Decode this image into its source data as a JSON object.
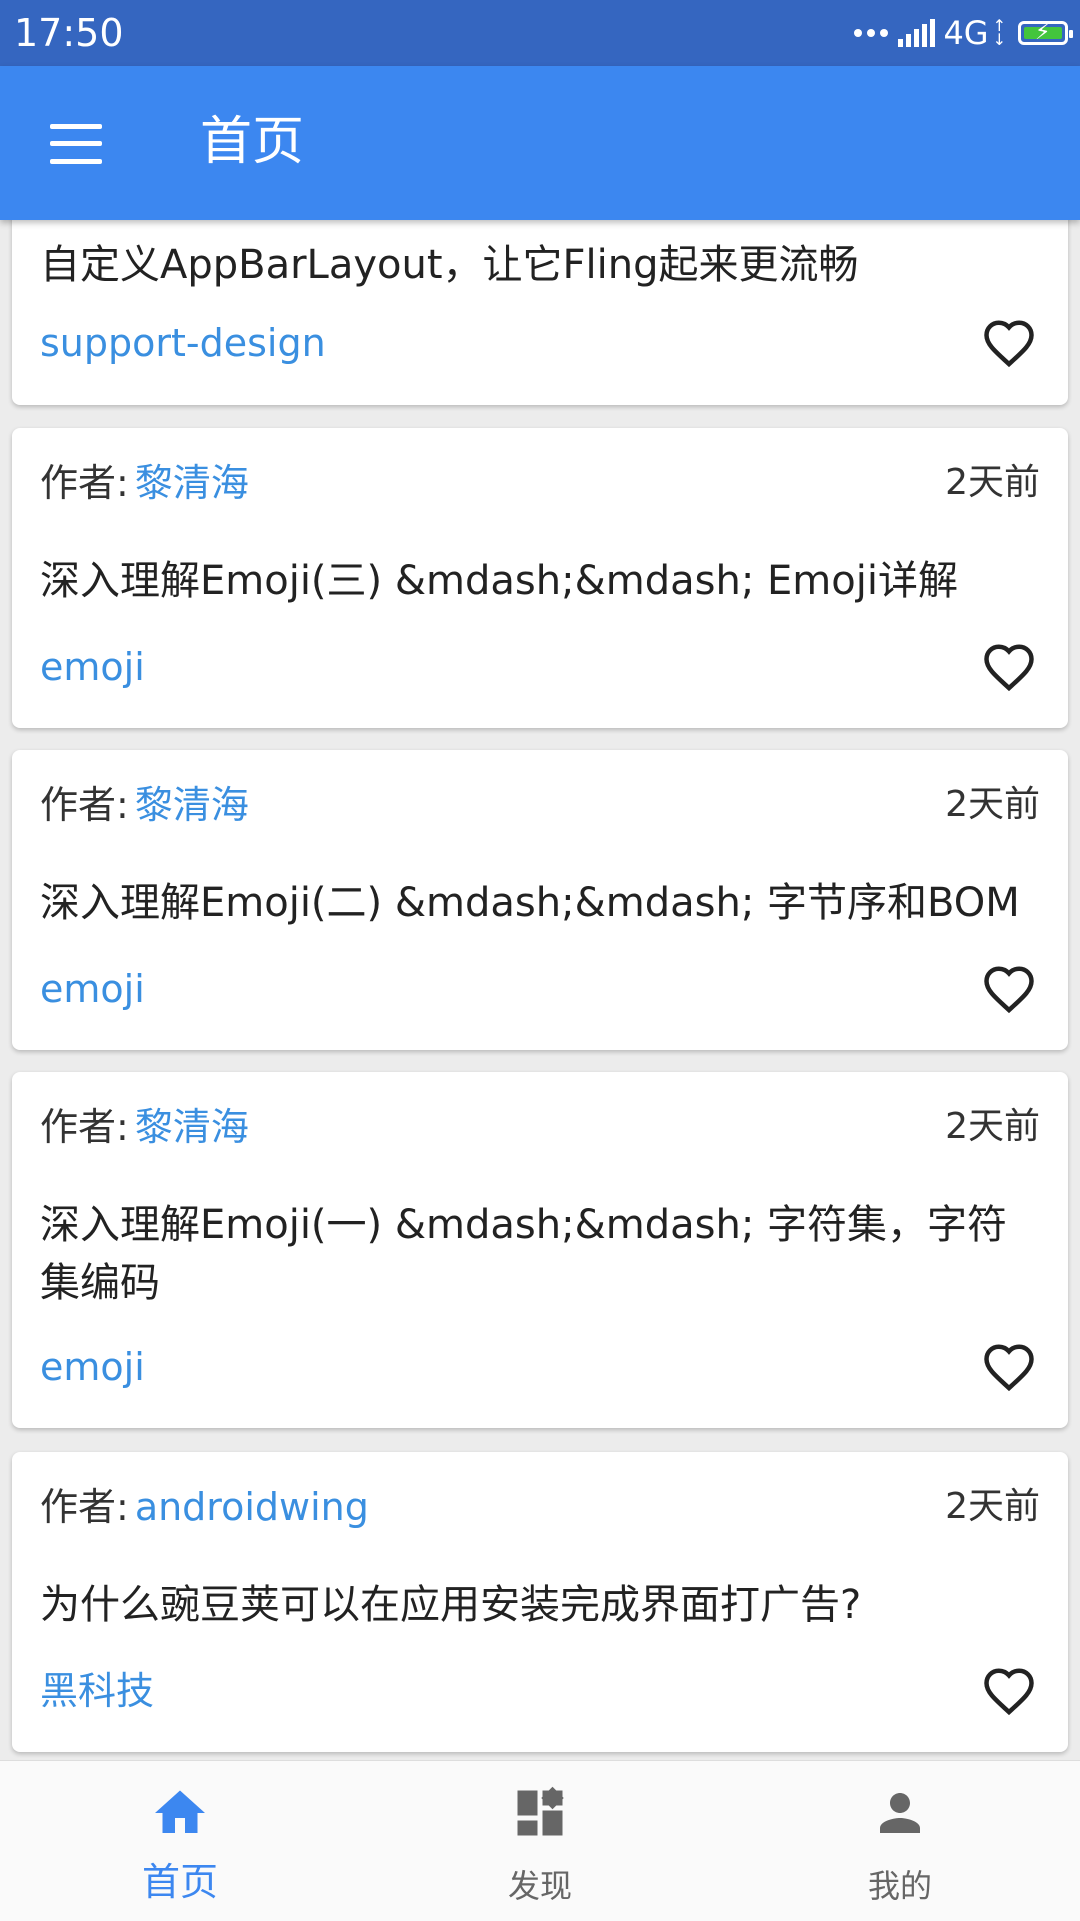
{
  "status_bar": {
    "time": "17:50",
    "network": "4G"
  },
  "app_bar": {
    "title": "首页"
  },
  "author_prefix": "作者:",
  "articles": [
    {
      "author": "",
      "time": "",
      "title": "自定义AppBarLayout，让它Fling起来更流畅",
      "tag": "support-design"
    },
    {
      "author": "黎清海",
      "time": "2天前",
      "title": "深入理解Emoji(三) &mdash;&mdash; Emoji详解",
      "tag": "emoji"
    },
    {
      "author": "黎清海",
      "time": "2天前",
      "title": "深入理解Emoji(二) &mdash;&mdash; 字节序和BOM",
      "tag": "emoji"
    },
    {
      "author": "黎清海",
      "time": "2天前",
      "title": "深入理解Emoji(一) &mdash;&mdash; 字符集，字符集编码",
      "tag": "emoji"
    },
    {
      "author": "androidwing",
      "time": "2天前",
      "title": "为什么豌豆荚可以在应用安装完成界面打广告?",
      "tag": "黑科技"
    }
  ],
  "bottom_nav": [
    {
      "label": "首页",
      "icon": "home-icon",
      "active": true
    },
    {
      "label": "发现",
      "icon": "discover-icon",
      "active": false
    },
    {
      "label": "我的",
      "icon": "person-icon",
      "active": false
    }
  ],
  "colors": {
    "status_bar": "#3566c0",
    "app_bar": "#3c87f0",
    "link": "#3a8fe0",
    "active_nav": "#3c87f0"
  }
}
